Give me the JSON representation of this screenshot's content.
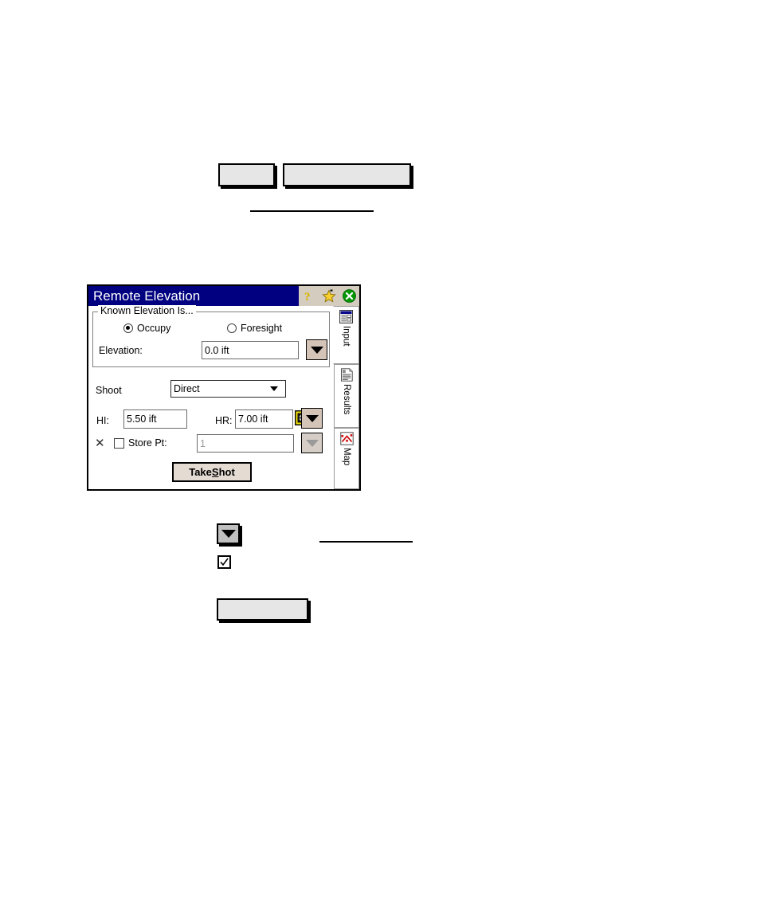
{
  "document": {
    "callout_boxes": [
      {
        "name": "small-callout-box",
        "label": ""
      },
      {
        "name": "wide-callout-box",
        "label": ""
      },
      {
        "name": "bottom-callout-box",
        "label": ""
      }
    ],
    "rules": [
      {
        "name": "underline-rule-top"
      },
      {
        "name": "underline-rule-bottom"
      }
    ],
    "legend_dropdown_label": "",
    "legend_checkbox_label": ""
  },
  "dialog": {
    "title": "Remote Elevation",
    "titlebar_icons": [
      {
        "name": "help-icon",
        "glyph": "?",
        "color": "#d8b400"
      },
      {
        "name": "favorite-star-icon",
        "glyph": "★",
        "color": "#f5c518"
      },
      {
        "name": "close-icon",
        "glyph": "✕",
        "color": "#008a00"
      }
    ],
    "accent_color": "#000080",
    "groupbox": {
      "title": "Known Elevation Is...",
      "radios": [
        {
          "name": "radio-occupy",
          "label": "Occupy",
          "selected": true
        },
        {
          "name": "radio-foresight",
          "label": "Foresight",
          "selected": false
        }
      ],
      "elevation": {
        "label": "Elevation:",
        "value": "0.0 ift",
        "dropdown_icon": "chevron-down-icon"
      }
    },
    "shoot": {
      "label": "Shoot",
      "value": "Direct",
      "options": [
        "Direct"
      ]
    },
    "hi": {
      "label": "HI:",
      "value": "5.50 ift"
    },
    "hr": {
      "label": "HR:",
      "value": "7.00 ift",
      "target_icon": "target-prism-icon",
      "dropdown_icon": "chevron-down-icon"
    },
    "store_pt": {
      "x_icon": "x-icon",
      "label": "Store Pt:",
      "checked": false,
      "value": "1",
      "enabled": false,
      "dropdown_icon": "chevron-down-icon"
    },
    "take_shot": {
      "label_before": "Take ",
      "label_accel": "S",
      "label_after": "hot"
    },
    "tabs": [
      {
        "name": "tab-input",
        "label": "Input",
        "icon": "form-window-icon",
        "active": true
      },
      {
        "name": "tab-results",
        "label": "Results",
        "icon": "document-report-icon",
        "active": false
      },
      {
        "name": "tab-map",
        "label": "Map",
        "icon": "map-points-icon",
        "active": false
      }
    ]
  }
}
